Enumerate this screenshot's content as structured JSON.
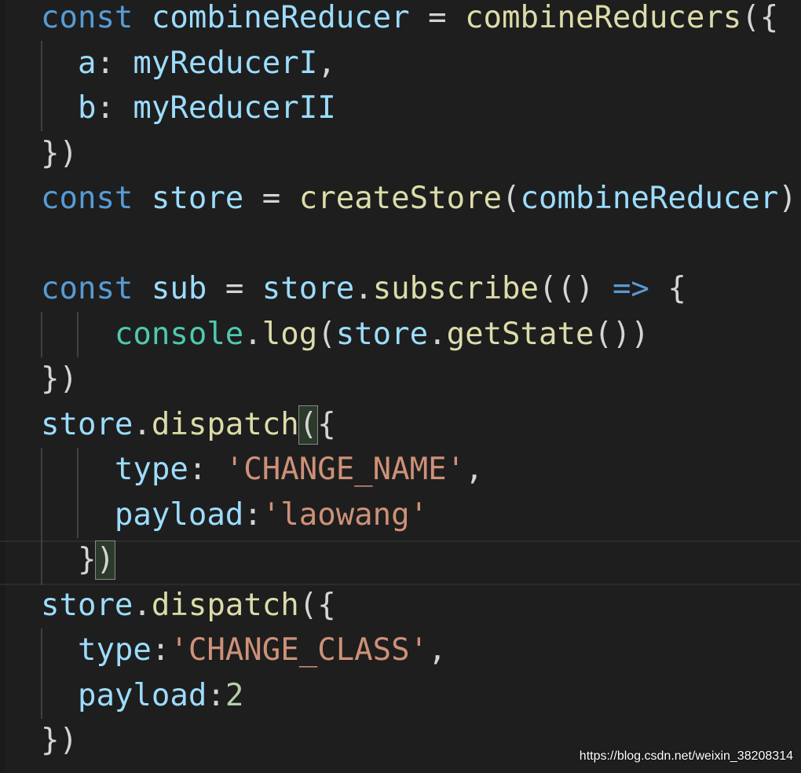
{
  "editor": {
    "lines": [
      [
        {
          "t": "const",
          "c": "kw"
        },
        {
          "t": " ",
          "c": "op"
        },
        {
          "t": "combineReducer",
          "c": "var"
        },
        {
          "t": " = ",
          "c": "op"
        },
        {
          "t": "combineReducers",
          "c": "fn"
        },
        {
          "t": "({",
          "c": "op"
        }
      ],
      [
        {
          "t": "  ",
          "c": "op"
        },
        {
          "t": "a",
          "c": "var"
        },
        {
          "t": ": ",
          "c": "op"
        },
        {
          "t": "myReducerI",
          "c": "var"
        },
        {
          "t": ",",
          "c": "op"
        }
      ],
      [
        {
          "t": "  ",
          "c": "op"
        },
        {
          "t": "b",
          "c": "var"
        },
        {
          "t": ": ",
          "c": "op"
        },
        {
          "t": "myReducerII",
          "c": "var"
        }
      ],
      [
        {
          "t": "})",
          "c": "op"
        }
      ],
      [
        {
          "t": "const",
          "c": "kw"
        },
        {
          "t": " ",
          "c": "op"
        },
        {
          "t": "store",
          "c": "var"
        },
        {
          "t": " = ",
          "c": "op"
        },
        {
          "t": "createStore",
          "c": "fn"
        },
        {
          "t": "(",
          "c": "op"
        },
        {
          "t": "combineReducer",
          "c": "var"
        },
        {
          "t": ")",
          "c": "op"
        }
      ],
      [],
      [
        {
          "t": "const",
          "c": "kw"
        },
        {
          "t": " ",
          "c": "op"
        },
        {
          "t": "sub",
          "c": "var"
        },
        {
          "t": " = ",
          "c": "op"
        },
        {
          "t": "store",
          "c": "var"
        },
        {
          "t": ".",
          "c": "op"
        },
        {
          "t": "subscribe",
          "c": "fn"
        },
        {
          "t": "(() ",
          "c": "op"
        },
        {
          "t": "=>",
          "c": "kw"
        },
        {
          "t": " {",
          "c": "op"
        }
      ],
      [
        {
          "t": "    ",
          "c": "op"
        },
        {
          "t": "console",
          "c": "cls"
        },
        {
          "t": ".",
          "c": "op"
        },
        {
          "t": "log",
          "c": "fn"
        },
        {
          "t": "(",
          "c": "op"
        },
        {
          "t": "store",
          "c": "var"
        },
        {
          "t": ".",
          "c": "op"
        },
        {
          "t": "getState",
          "c": "fn"
        },
        {
          "t": "())",
          "c": "op"
        }
      ],
      [
        {
          "t": "})",
          "c": "op"
        }
      ],
      [
        {
          "t": "store",
          "c": "var"
        },
        {
          "t": ".",
          "c": "op"
        },
        {
          "t": "dispatch",
          "c": "fn"
        },
        {
          "t": "(",
          "c": "op",
          "box": true
        },
        {
          "t": "{",
          "c": "op"
        }
      ],
      [
        {
          "t": "    ",
          "c": "op"
        },
        {
          "t": "type",
          "c": "var"
        },
        {
          "t": ": ",
          "c": "op"
        },
        {
          "t": "'CHANGE_NAME'",
          "c": "str"
        },
        {
          "t": ",",
          "c": "op"
        }
      ],
      [
        {
          "t": "    ",
          "c": "op"
        },
        {
          "t": "payload",
          "c": "var"
        },
        {
          "t": ":",
          "c": "op"
        },
        {
          "t": "'laowang'",
          "c": "str"
        }
      ],
      [
        {
          "t": "  }",
          "c": "op"
        },
        {
          "t": ")",
          "c": "op",
          "box": true
        }
      ],
      [
        {
          "t": "store",
          "c": "var"
        },
        {
          "t": ".",
          "c": "op"
        },
        {
          "t": "dispatch",
          "c": "fn"
        },
        {
          "t": "({",
          "c": "op"
        }
      ],
      [
        {
          "t": "  ",
          "c": "op"
        },
        {
          "t": "type",
          "c": "var"
        },
        {
          "t": ":",
          "c": "op"
        },
        {
          "t": "'CHANGE_CLASS'",
          "c": "str"
        },
        {
          "t": ",",
          "c": "op"
        }
      ],
      [
        {
          "t": "  ",
          "c": "op"
        },
        {
          "t": "payload",
          "c": "var"
        },
        {
          "t": ":",
          "c": "op"
        },
        {
          "t": "2",
          "c": "num"
        }
      ],
      [
        {
          "t": "})",
          "c": "op"
        }
      ]
    ]
  },
  "watermark": "https://blog.csdn.net/weixin_38208314",
  "colors": {
    "background": "#1e1e1e",
    "keyword": "#569cd6",
    "variable": "#9cdcfe",
    "function": "#dcdcaa",
    "string": "#ce9178",
    "number": "#b5cea8",
    "class": "#4ec9b0"
  }
}
